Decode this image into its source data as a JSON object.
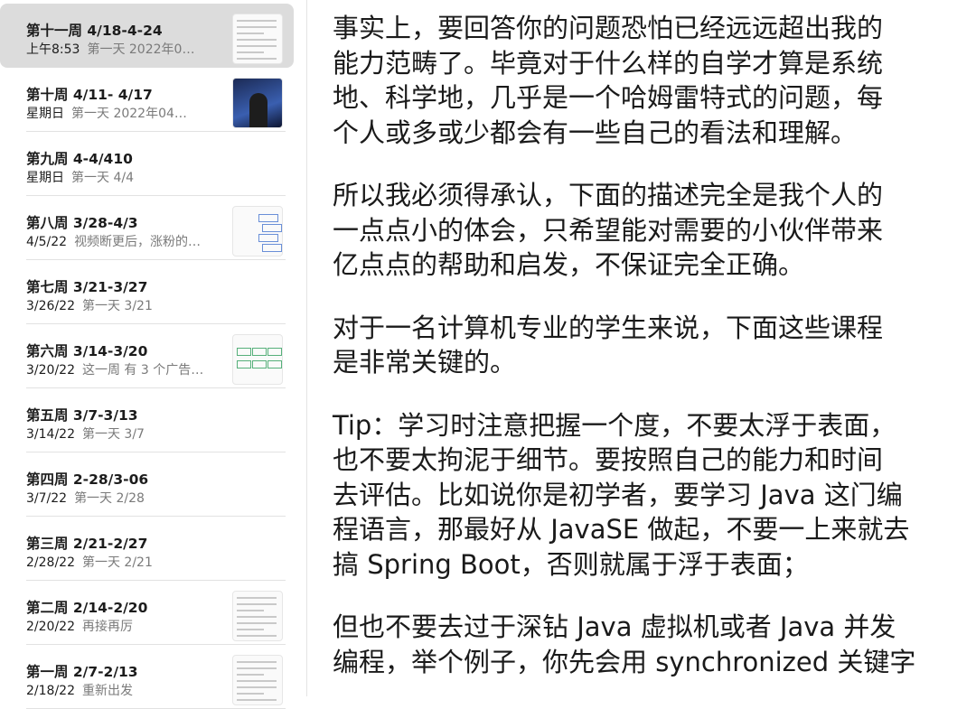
{
  "notes": [
    {
      "title": "第十一周 4/18-4-24",
      "date": "上午8:53",
      "preview": "第一天 2022年0…",
      "selected": true,
      "thumb": "text"
    },
    {
      "title": "第十周 4/11- 4/17",
      "date": "星期日",
      "preview": "第一天 2022年04…",
      "selected": false,
      "thumb": "video"
    },
    {
      "title": "第九周 4-4/410",
      "date": "星期日",
      "preview": "第一天 4/4",
      "selected": false,
      "thumb": "none"
    },
    {
      "title": "第八周 3/28-4/3",
      "date": "4/5/22",
      "preview": "视频断更后，涨粉的…",
      "selected": false,
      "thumb": "diagram"
    },
    {
      "title": "第七周 3/21-3/27",
      "date": "3/26/22",
      "preview": "第一天 3/21",
      "selected": false,
      "thumb": "none"
    },
    {
      "title": "第六周 3/14-3/20",
      "date": "3/20/22",
      "preview": "这一周 有 3 个广告…",
      "selected": false,
      "thumb": "tags"
    },
    {
      "title": "第五周 3/7-3/13",
      "date": "3/14/22",
      "preview": "第一天 3/7",
      "selected": false,
      "thumb": "none"
    },
    {
      "title": "第四周 2-28/3-06",
      "date": "3/7/22",
      "preview": "第一天 2/28",
      "selected": false,
      "thumb": "none"
    },
    {
      "title": "第三周 2/21-2/27",
      "date": "2/28/22",
      "preview": "第一天 2/21",
      "selected": false,
      "thumb": "none"
    },
    {
      "title": "第二周 2/14-2/20",
      "date": "2/20/22",
      "preview": "再接再厉",
      "selected": false,
      "thumb": "text"
    },
    {
      "title": "第一周 2/7-2/13",
      "date": "2/18/22",
      "preview": "重新出发",
      "selected": false,
      "thumb": "text"
    }
  ],
  "content": {
    "paragraphs": [
      [
        "事实上，要回答你的问题恐怕已经远远超出我的",
        "能力范畴了。毕竟对于什么样的自学才算是系统",
        "地、科学地，几乎是一个哈姆雷特式的问题，每",
        "个人或多或少都会有一些自己的看法和理解。"
      ],
      [
        "所以我必须得承认，下面的描述完全是我个人的",
        "一点点小的体会，只希望能对需要的小伙伴带来",
        "亿点点的帮助和启发，不保证完全正确。"
      ],
      [
        "对于一名计算机专业的学生来说，下面这些课程",
        "是非常关键的。"
      ],
      [
        "Tip：学习时注意把握一个度，不要太浮于表面，",
        "也不要太拘泥于细节。要按照自己的能力和时间",
        "去评估。比如说你是初学者，要学习 Java 这门编",
        "程语言，那最好从 JavaSE 做起，不要一上来就去",
        "搞 Spring Boot，否则就属于浮于表面；"
      ],
      [
        "但也不要去过于深钻 Java 虚拟机或者 Java 并发",
        "编程，举个例子，你先会用 synchronized 关键字"
      ]
    ]
  },
  "colors": {
    "selected_bg": "#dcdcdc",
    "text": "#1a1a1a",
    "secondary": "#7a7a7a"
  }
}
